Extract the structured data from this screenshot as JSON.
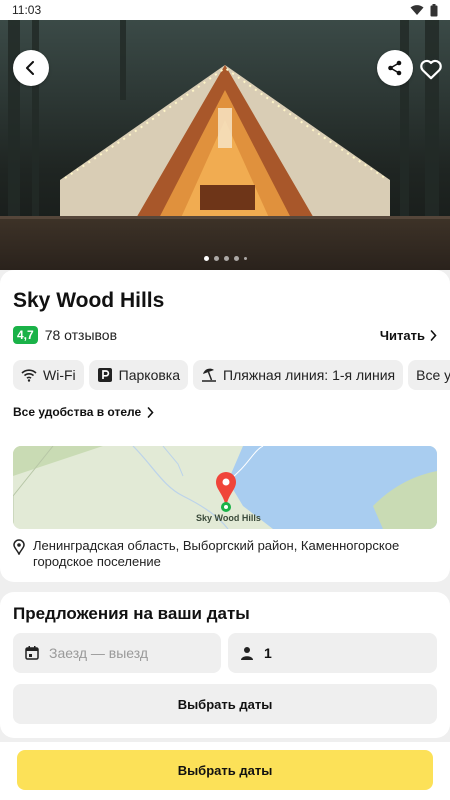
{
  "status_bar": {
    "time": "11:03"
  },
  "hotel": {
    "name": "Sky Wood Hills",
    "rating": "4,7",
    "reviews": "78 отзывов",
    "read_label": "Читать"
  },
  "amenities": [
    {
      "icon": "wifi-icon",
      "label": "Wi-Fi"
    },
    {
      "icon": "parking-icon",
      "label": "Парковка"
    },
    {
      "icon": "beach-icon",
      "label": "Пляжная линия: 1-я линия"
    },
    {
      "icon": "",
      "label": "Все удобства"
    }
  ],
  "all_amenities_label": "Все удобства в отеле",
  "map": {
    "label": "Sky Wood Hills"
  },
  "address": "Ленинградская область, Выборгский район, Каменногорское городское поселение",
  "offers": {
    "title": "Предложения на ваши даты",
    "dates_placeholder": "Заезд — выезд",
    "guests": "1",
    "choose_dates_label": "Выбрать даты"
  },
  "bottom": {
    "primary_label": "Выбрать даты"
  },
  "gallery": {
    "dot_count": 5,
    "active_index": 0
  },
  "colors": {
    "rating_green": "#1ab248",
    "primary_yellow": "#fce158",
    "map_pin_red": "#f0453a"
  }
}
